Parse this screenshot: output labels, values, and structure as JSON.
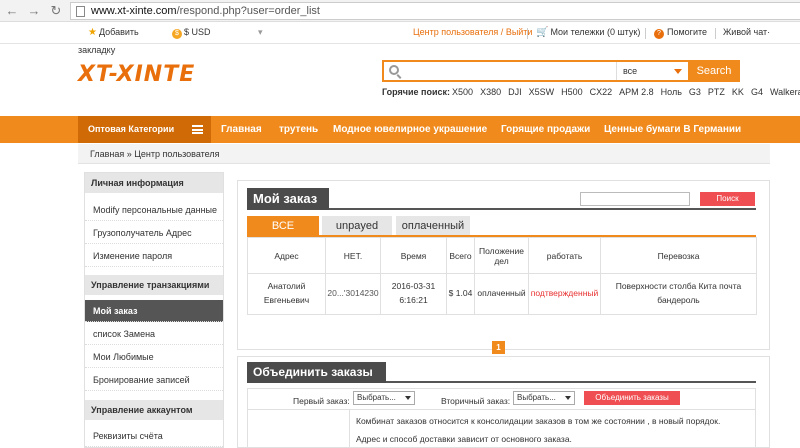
{
  "browser": {
    "url_host": "www.xt-xinte.com",
    "url_path": "/respond.php?user=order_list"
  },
  "util": {
    "bookmark_label": "Добавить",
    "currency": "$ USD",
    "user_center": "Центр пользователя",
    "slash": "/",
    "logout": "Выйти",
    "cart": "Мои тележки (0 штук)",
    "help": "Помогите",
    "live_chat": "Живой чат·",
    "bookmark_tail": "закладку"
  },
  "logo": {
    "text": "XT-XINTE"
  },
  "search": {
    "placeholder": "",
    "select_value": "все",
    "button": "Search"
  },
  "hot": {
    "label": "Горячие поиск:",
    "keywords": [
      "X500",
      "X380",
      "DJI",
      "X5SW",
      "H500",
      "CX22",
      "APM 2.8",
      "Ноль",
      "G3",
      "PTZ",
      "KK",
      "G4",
      "Walkera"
    ]
  },
  "nav": {
    "categories": "Оптовая Категории",
    "items": [
      "Главная",
      "трутень",
      "Модное ювелирное украшение",
      "Горящие продажи",
      "Ценные бумаги В Германии"
    ]
  },
  "breadcrumb": "Главная » Центр пользователя",
  "sidebar": {
    "sections": [
      {
        "title": "Личная информация",
        "items": [
          "Modify персональные данные",
          "Грузополучатель Адрес",
          "Изменение пароля"
        ]
      },
      {
        "title": "Управление транзакциями",
        "items": [
          "Мой заказ",
          "список Замена",
          "Мои Любимые",
          "Бронирование записей"
        ]
      },
      {
        "title": "Управление аккаунтом",
        "items": [
          "Реквизиты счёта"
        ]
      }
    ]
  },
  "orders": {
    "title": "Мой заказ",
    "search_value": "",
    "search_button": "Поиск",
    "tabs": [
      "ВСЕ",
      "unpayed",
      "оплаченный"
    ],
    "columns": [
      "Адрес",
      "НЕТ.",
      "Время",
      "Всего",
      "Положение дел",
      "работать",
      "Перевозка"
    ],
    "rows": [
      {
        "address": "Анатолий Евгеньевич",
        "number": "20...'3014230",
        "time": "2016-03-31 6:16:21",
        "total": "$ 1.04",
        "status": "оплаченный",
        "work": "подтвержденный",
        "shipping": "Поверхности столба Кита почта бандероль"
      }
    ],
    "page": "1"
  },
  "merge": {
    "title": "Объединить заказы",
    "first_label": "Первый заказ:",
    "first_select": "Выбрать...",
    "second_label": "Вторичный заказ:",
    "second_select": "Выбрать...",
    "button": "Объединить заказы",
    "note1": "Комбинат заказов относится к консолидации заказов в том же состоянии , в новый порядок.",
    "note2": "Адрес и способ доставки зависит от основного заказа."
  }
}
